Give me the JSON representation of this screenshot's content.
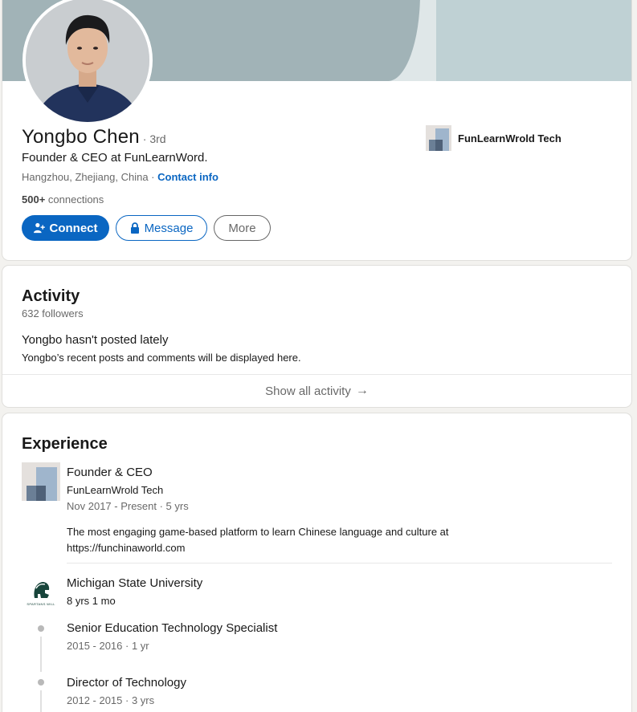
{
  "profile": {
    "name": "Yongbo Chen",
    "degree": "· 3rd",
    "headline": "Founder & CEO at FunLearnWord.",
    "location": "Hangzhou, Zhejiang, China",
    "location_sep": " · ",
    "contact_info": "Contact info",
    "connections_count": "500+",
    "connections_label": " connections",
    "current_company": "FunLearnWrold Tech"
  },
  "actions": {
    "connect": "Connect",
    "message": "Message",
    "more": "More"
  },
  "activity": {
    "title": "Activity",
    "followers": "632 followers",
    "empty_title": "Yongbo hasn't posted lately",
    "empty_sub": "Yongbo’s recent posts and comments will be displayed here.",
    "show_all": "Show all activity",
    "show_all_arrow": "→"
  },
  "experience": {
    "title": "Experience",
    "items": [
      {
        "title": "Founder & CEO",
        "company": "FunLearnWrold Tech",
        "dates": "Nov 2017 - Present · 5 yrs",
        "description": "The most engaging game-based platform to learn Chinese language and culture at https://funchinaworld.com"
      },
      {
        "company": "Michigan State University",
        "duration": "8 yrs 1 mo",
        "logo_text": "SPARTANS WILL",
        "roles": [
          {
            "title": "Senior Education Technology Specialist",
            "dates": "2015 - 2016 · 1 yr"
          },
          {
            "title": "Director of Technology",
            "dates": "2012 - 2015 · 3 yrs"
          }
        ]
      }
    ]
  },
  "colors": {
    "brand_blue": "#0a66c2",
    "msu_green": "#18453b"
  }
}
